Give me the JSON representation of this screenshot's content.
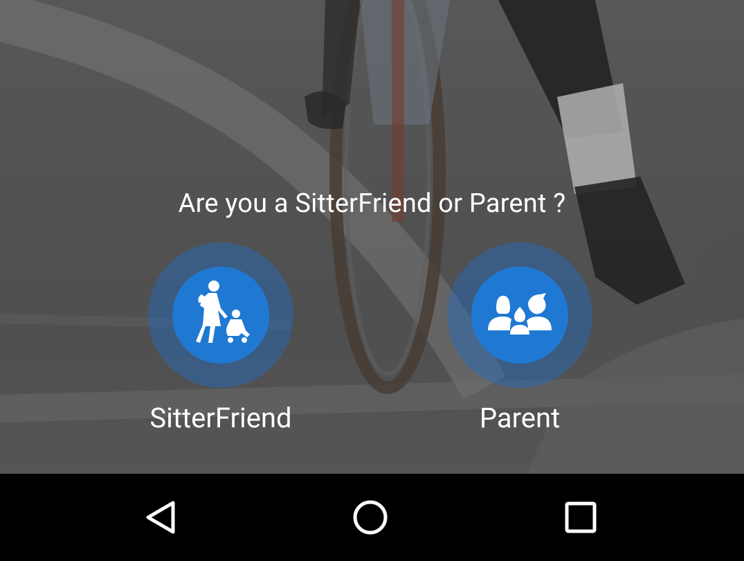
{
  "prompt": {
    "question": "Are you a SitterFriend or Parent ?"
  },
  "choices": [
    {
      "id": "sitterfriend",
      "label": "SitterFriend",
      "icon": "nanny-with-stroller-icon"
    },
    {
      "id": "parent",
      "label": "Parent",
      "icon": "family-icon"
    }
  ],
  "navigation_bar": {
    "back": "back-triangle-icon",
    "home": "home-circle-icon",
    "recents": "recents-square-icon"
  },
  "colors": {
    "accent": "#1f79d3",
    "halo": "#1e6ec8",
    "text": "#ffffff",
    "navbar": "#000000"
  }
}
